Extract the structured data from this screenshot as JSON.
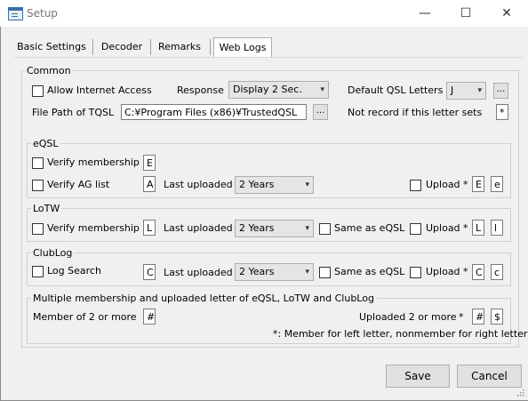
{
  "window": {
    "title": "Setup",
    "minimize": "—",
    "maximize": "☐",
    "close": "✕"
  },
  "tabs": [
    "Basic Settings",
    "Decoder",
    "Remarks",
    "Web Logs"
  ],
  "common": {
    "label": "Common",
    "allow_internet": {
      "label": "Allow Internet Access",
      "checked": false
    },
    "response_label": "Response",
    "response_value": "Display 2 Sec.",
    "default_qsl_label": "Default QSL Letters",
    "default_qsl_value": "J",
    "file_path_label": "File Path of TQSL",
    "file_path_value": "C:¥Program Files (x86)¥TrustedQSL",
    "browse": "...",
    "not_record_label": "Not record if this letter sets",
    "not_record_value": "*"
  },
  "eqsl": {
    "label": "eQSL",
    "verify_membership": {
      "label": "Verify membership",
      "checked": false,
      "letter": "E"
    },
    "verify_ag": {
      "label": "Verify AG list",
      "checked": false,
      "letter": "A"
    },
    "last_uploaded_label": "Last uploaded",
    "last_uploaded_value": "2 Years",
    "upload": {
      "label": "Upload",
      "checked": false,
      "star": "*",
      "left": "E",
      "right": "e"
    }
  },
  "lotw": {
    "label": "LoTW",
    "verify_membership": {
      "label": "Verify membership",
      "checked": false,
      "letter": "L"
    },
    "last_uploaded_label": "Last uploaded",
    "last_uploaded_value": "2 Years",
    "same_as": {
      "label": "Same as eQSL",
      "checked": false
    },
    "upload": {
      "label": "Upload",
      "checked": false,
      "star": "*",
      "left": "L",
      "right": "l"
    }
  },
  "clublog": {
    "label": "ClubLog",
    "log_search": {
      "label": "Log Search",
      "checked": false,
      "letter": "C"
    },
    "last_uploaded_label": "Last uploaded",
    "last_uploaded_value": "2 Years",
    "same_as": {
      "label": "Same as eQSL",
      "checked": false
    },
    "upload": {
      "label": "Upload",
      "checked": false,
      "star": "*",
      "left": "C",
      "right": "c"
    }
  },
  "multiple": {
    "label": "Multiple membership and uploaded letter of eQSL, LoTW and ClubLog",
    "member_label": "Member of 2 or more",
    "member_value": "#",
    "uploaded_label": "Uploaded 2 or more",
    "uploaded_star": "*",
    "uploaded_left": "#",
    "uploaded_right": "$",
    "note": "*: Member for left letter, nonmember for right letter"
  },
  "buttons": {
    "save": "Save",
    "cancel": "Cancel"
  }
}
